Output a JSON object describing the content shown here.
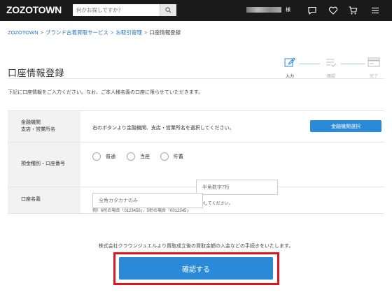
{
  "header": {
    "logo": "ZOZOTOWN",
    "search_placeholder": "何かお探しですか？",
    "user_suffix": "様"
  },
  "breadcrumb": [
    {
      "label": "ZOZOTOWN"
    },
    {
      "label": "ブランド古着買取サービス"
    },
    {
      "label": "お取引管理"
    },
    {
      "label": "口座情報登録"
    }
  ],
  "page": {
    "title": "口座情報登録",
    "intro": "下記に口座情報をご入力ください。なお、ご本人様名義の口座に限らせていただきます。"
  },
  "steps": [
    {
      "label": "入力",
      "active": true
    },
    {
      "label": "確認",
      "active": false
    },
    {
      "label": "完了",
      "active": false
    }
  ],
  "form": {
    "bank": {
      "label_line1": "金融機関",
      "label_line2": "支店・営業所名",
      "desc": "右のボタンより金融機関、支店・営業所名を選択してください。",
      "button": "金融機関選択"
    },
    "account": {
      "label": "預金種別・口座番号",
      "options": [
        "普通",
        "当座",
        "貯蓄"
      ],
      "number_placeholder": "半角数字7桁",
      "note1": "※口座番号が6桁以下の場合は頭に「0」を加えた7桁で入力してください。",
      "note2": "例）6桁の場合「0123456」、5桁の場合「0012345」"
    },
    "name": {
      "label": "口座名義",
      "placeholder": "全角カタカナのみ"
    }
  },
  "confirm": {
    "notice": "株式会社クラウンジュエルより買取成立後の買取金額の入金などの手続きをいたします。",
    "button": "確認する"
  },
  "colors": {
    "accent": "#2a8ad8",
    "highlight": "#e0141c",
    "header_bg": "#1a1a1a"
  }
}
